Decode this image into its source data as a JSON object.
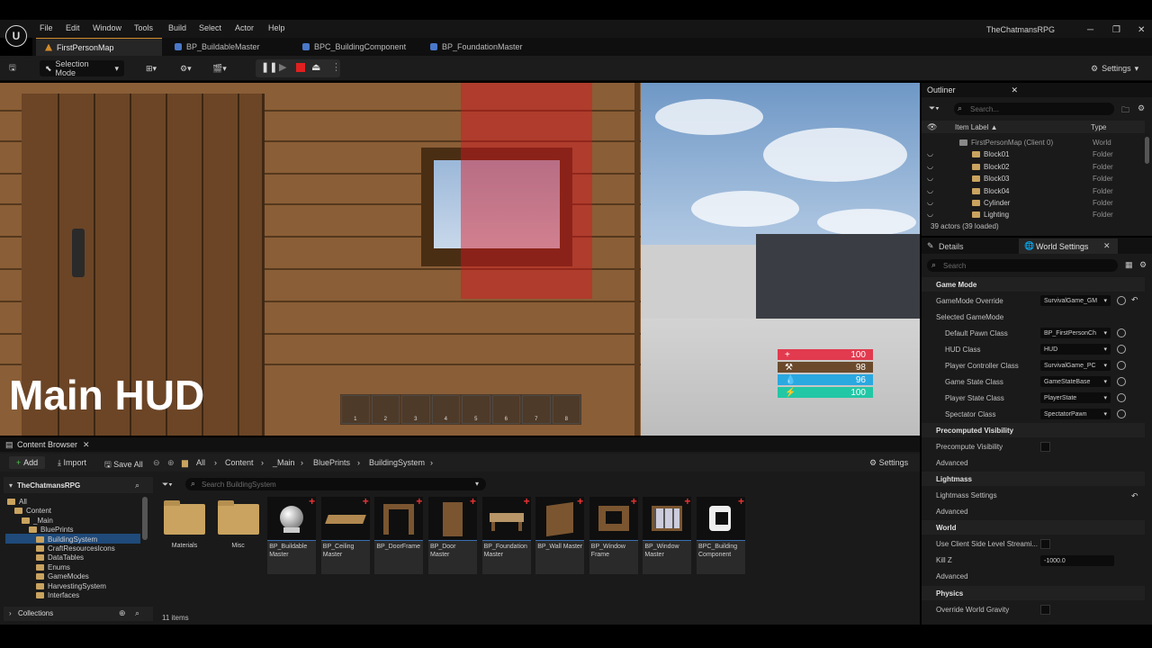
{
  "menu": [
    "File",
    "Edit",
    "Window",
    "Tools",
    "Build",
    "Select",
    "Actor",
    "Help"
  ],
  "project_name": "TheChatmansRPG",
  "tabs": [
    {
      "label": "FirstPersonMap",
      "active": true
    },
    {
      "label": "BP_BuildableMaster"
    },
    {
      "label": "BPC_BuildingComponent"
    },
    {
      "label": "BP_FoundationMaster"
    }
  ],
  "toolbar": {
    "selection_mode": "Selection Mode",
    "settings": "Settings"
  },
  "viewport": {
    "hud_title": "Main HUD",
    "hotbar_slots": [
      "1",
      "2",
      "3",
      "4",
      "5",
      "6",
      "7",
      "8"
    ],
    "stats": [
      {
        "name": "health",
        "value": "100",
        "color": "#e23a4f",
        "icon": "+"
      },
      {
        "name": "stamina",
        "value": "98",
        "color": "#6b4a2c",
        "icon": "⚒"
      },
      {
        "name": "water",
        "value": "96",
        "color": "#2aa8e0",
        "icon": "💧"
      },
      {
        "name": "energy",
        "value": "100",
        "color": "#22c7a5",
        "icon": "⚡"
      }
    ]
  },
  "outliner": {
    "title": "Outliner",
    "search_placeholder": "Search...",
    "col_label": "Item Label ▲",
    "col_type": "Type",
    "rows": [
      {
        "label": "FirstPersonMap (Client 0)",
        "type": "World",
        "indent": 0
      },
      {
        "label": "Block01",
        "type": "Folder",
        "indent": 1
      },
      {
        "label": "Block02",
        "type": "Folder",
        "indent": 1
      },
      {
        "label": "Block03",
        "type": "Folder",
        "indent": 1
      },
      {
        "label": "Block04",
        "type": "Folder",
        "indent": 1
      },
      {
        "label": "Cylinder",
        "type": "Folder",
        "indent": 1
      },
      {
        "label": "Lighting",
        "type": "Folder",
        "indent": 1
      }
    ],
    "footer": "39 actors (39 loaded)"
  },
  "details": {
    "tab_details": "Details",
    "tab_world": "World Settings",
    "search_placeholder": "Search",
    "sections": {
      "game_mode": "Game Mode",
      "selected_game_mode": "Selected GameMode",
      "precomputed": "Precomputed Visibility",
      "lightmass": "Lightmass",
      "world": "World",
      "physics": "Physics"
    },
    "props": {
      "gamemode_override": {
        "label": "GameMode Override",
        "value": "SurvivalGame_GM"
      },
      "default_pawn": {
        "label": "Default Pawn Class",
        "value": "BP_FirstPersonCh"
      },
      "hud_class": {
        "label": "HUD Class",
        "value": "HUD"
      },
      "player_controller": {
        "label": "Player Controller Class",
        "value": "SurvivalGame_PC"
      },
      "game_state": {
        "label": "Game State Class",
        "value": "GameStateBase"
      },
      "player_state": {
        "label": "Player State Class",
        "value": "PlayerState"
      },
      "spectator": {
        "label": "Spectator Class",
        "value": "SpectatorPawn"
      },
      "precompute_visibility": "Precompute Visibility",
      "advanced": "Advanced",
      "lightmass_settings": "Lightmass Settings",
      "use_client_side": "Use Client Side Level Streami...",
      "kill_z": {
        "label": "Kill Z",
        "value": "-1000.0"
      },
      "override_gravity": "Override World Gravity"
    }
  },
  "content_browser": {
    "title": "Content Browser",
    "add": "Add",
    "import": "Import",
    "save_all": "Save All",
    "settings": "Settings",
    "breadcrumb": [
      "All",
      "Content",
      "_Main",
      "BluePrints",
      "BuildingSystem"
    ],
    "search_placeholder": "Search BuildingSystem",
    "root": "TheChatmansRPG",
    "tree": [
      {
        "label": "All",
        "indent": 0
      },
      {
        "label": "Content",
        "indent": 1
      },
      {
        "label": "_Main",
        "indent": 2
      },
      {
        "label": "BluePrints",
        "indent": 3
      },
      {
        "label": "BuildingSystem",
        "indent": 4,
        "selected": true
      },
      {
        "label": "CraftResourcesIcons",
        "indent": 4
      },
      {
        "label": "DataTables",
        "indent": 4
      },
      {
        "label": "Enums",
        "indent": 4
      },
      {
        "label": "GameModes",
        "indent": 4
      },
      {
        "label": "HarvestingSystem",
        "indent": 4
      },
      {
        "label": "Interfaces",
        "indent": 4
      }
    ],
    "collections": "Collections",
    "item_count": "11 items",
    "assets": [
      {
        "label": "Materials",
        "kind": "folder"
      },
      {
        "label": "Misc",
        "kind": "folder"
      },
      {
        "label": "BP_Buildable Master",
        "kind": "sphere"
      },
      {
        "label": "BP_Ceiling Master",
        "kind": "ceiling"
      },
      {
        "label": "BP_DoorFrame",
        "kind": "doorframe"
      },
      {
        "label": "BP_Door Master",
        "kind": "door"
      },
      {
        "label": "BP_Foundation Master",
        "kind": "foundation"
      },
      {
        "label": "BP_Wall Master",
        "kind": "wall"
      },
      {
        "label": "BP_Window Frame",
        "kind": "windowframe"
      },
      {
        "label": "BP_Window Master",
        "kind": "window"
      },
      {
        "label": "BPC_Building Component",
        "kind": "component"
      }
    ]
  }
}
